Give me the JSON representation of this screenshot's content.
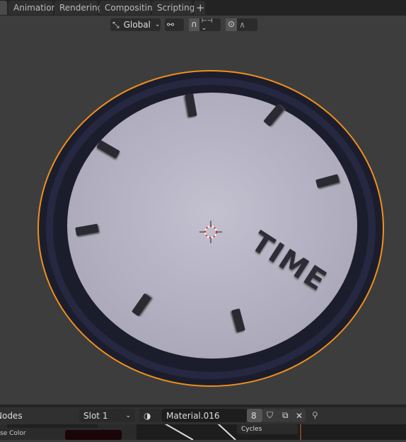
{
  "workspace_tabs": [
    {
      "label": "Animation"
    },
    {
      "label": "Rendering"
    },
    {
      "label": "Compositing"
    },
    {
      "label": "Scripting"
    }
  ],
  "add_tab": "+",
  "viewport_header": {
    "orientation": "Global",
    "icons": [
      "transform-orientation-icon",
      "pivot-icon",
      "snap-magnet-icon",
      "snap-increment-icon",
      "proportional-edit-icon",
      "falloff-curve-icon"
    ]
  },
  "scene": {
    "text": "TIME",
    "accent": "#f0901e"
  },
  "node_editor": {
    "title": "Nodes",
    "slot": "Slot 1",
    "material": "Material.016",
    "users": "8",
    "render_engine": "Cycles",
    "left_label": "se Color"
  }
}
